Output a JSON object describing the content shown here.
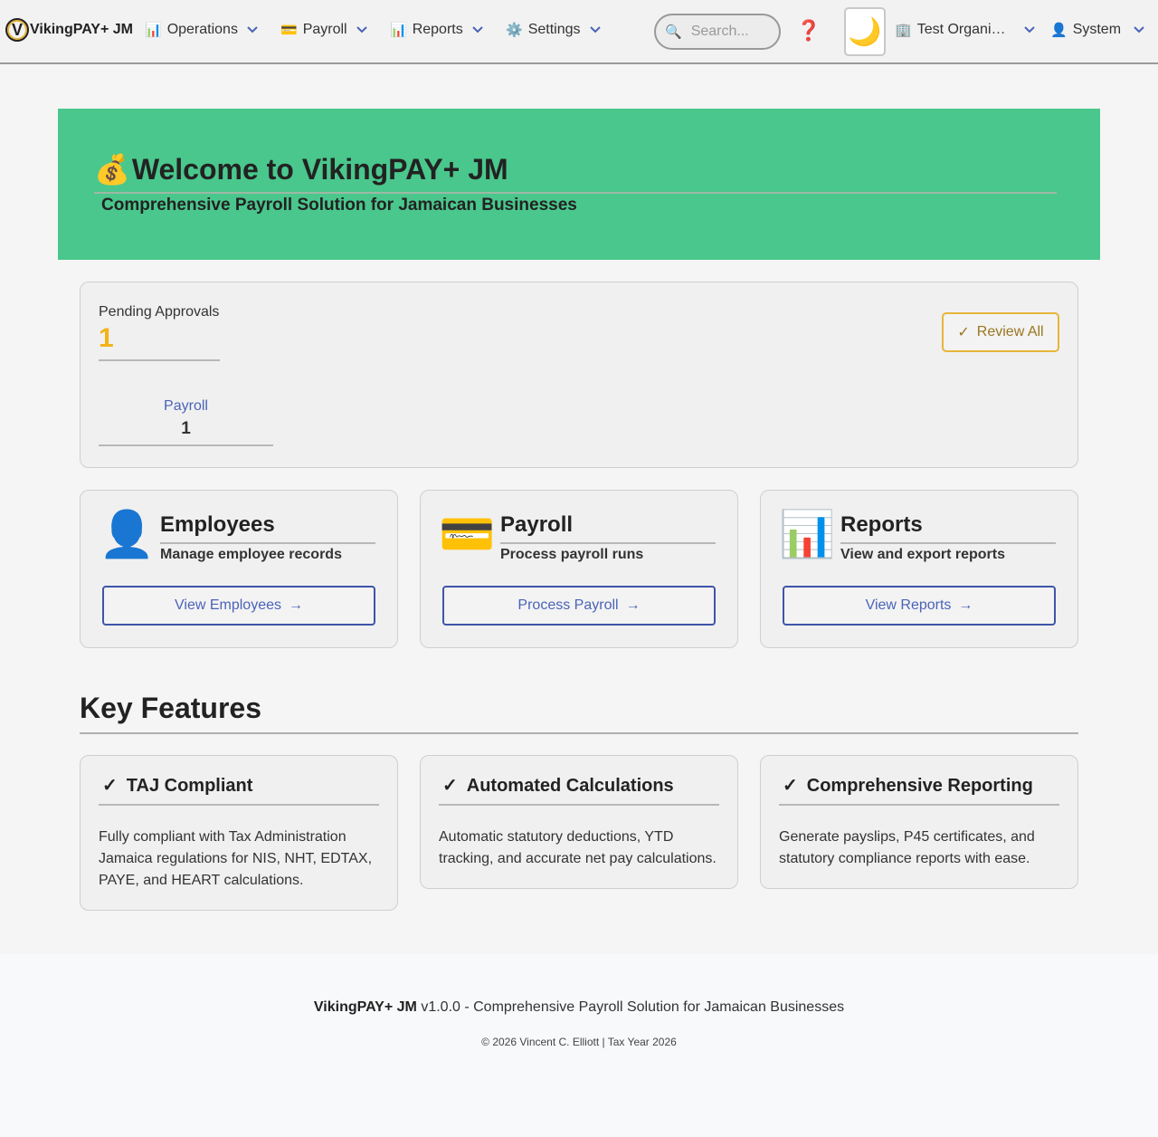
{
  "nav": {
    "logo_letter": "V",
    "brand": "VikingPAY+ JM",
    "menus": [
      {
        "icon": "📊",
        "label": "Operations"
      },
      {
        "icon": "💳",
        "label": "Payroll"
      },
      {
        "icon": "📊",
        "label": "Reports"
      },
      {
        "icon": "⚙️",
        "label": "Settings"
      }
    ],
    "search_icon": "🔍",
    "search_placeholder": "Search...",
    "help_icon": "❓",
    "theme_icon": "🌙",
    "organization": {
      "icon": "🏢",
      "label": "Test Organi…"
    },
    "user": {
      "icon": "👤",
      "label": "System"
    },
    "chevron_color": "#4a63b8"
  },
  "hero": {
    "emoji": "💰",
    "title": "Welcome to VikingPAY+ JM",
    "subtitle": "Comprehensive Payroll Solution for Jamaican Businesses",
    "background": "#4ac78c"
  },
  "approvals": {
    "label": "Pending Approvals",
    "count": "1",
    "review_button": "Review All",
    "review_check": "✓",
    "types": [
      {
        "label": "Payroll",
        "count": "1"
      }
    ]
  },
  "quick_actions": [
    {
      "icon": "👤",
      "title": "Employees",
      "description": "Manage employee records",
      "button": "View Employees",
      "arrow": "→"
    },
    {
      "icon": "💳",
      "title": "Payroll",
      "description": "Process payroll runs",
      "button": "Process Payroll",
      "arrow": "→"
    },
    {
      "icon": "📊",
      "title": "Reports",
      "description": "View and export reports",
      "button": "View Reports",
      "arrow": "→"
    }
  ],
  "features": {
    "title": "Key Features",
    "check": "✓",
    "items": [
      {
        "title": "TAJ Compliant",
        "description": "Fully compliant with Tax Administration Jamaica regulations for NIS, NHT, EDTAX, PAYE, and HEART calculations."
      },
      {
        "title": "Automated Calculations",
        "description": "Automatic statutory deductions, YTD tracking, and accurate net pay calculations."
      },
      {
        "title": "Comprehensive Reporting",
        "description": "Generate payslips, P45 certificates, and statutory compliance reports with ease."
      }
    ]
  },
  "footer": {
    "brand": "VikingPAY+ JM",
    "version_text": " v1.0.0 - Comprehensive Payroll Solution for Jamaican Businesses",
    "copyright": "© 2026 Vincent C. Elliott | Tax Year 2026"
  }
}
